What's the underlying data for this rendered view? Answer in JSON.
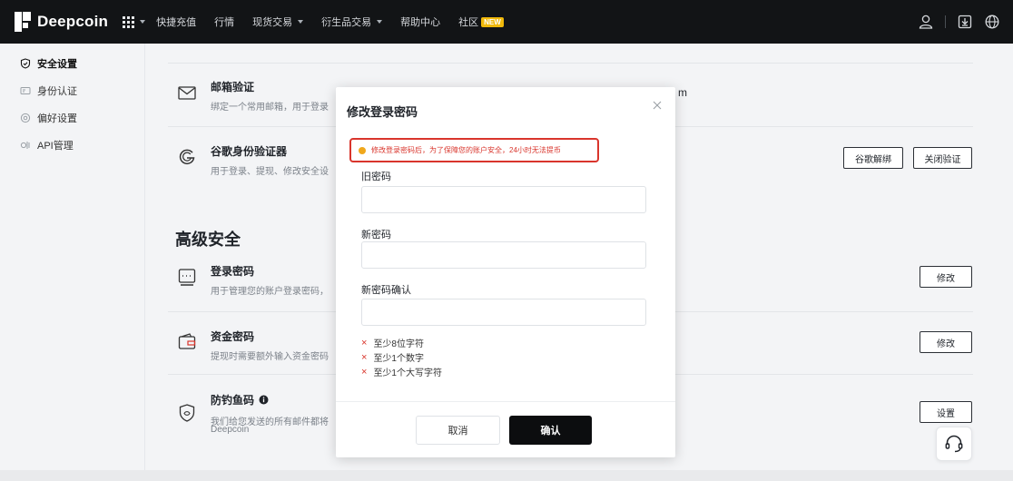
{
  "brand": {
    "name": "Deepcoin"
  },
  "nav": {
    "items": [
      {
        "label": "快捷充值",
        "has_dropdown": false
      },
      {
        "label": "行情",
        "has_dropdown": false
      },
      {
        "label": "现货交易",
        "has_dropdown": true
      },
      {
        "label": "衍生品交易",
        "has_dropdown": true
      },
      {
        "label": "帮助中心",
        "has_dropdown": false
      },
      {
        "label": "社区",
        "has_dropdown": false,
        "badge": "NEW"
      }
    ],
    "right_icons": [
      "user-icon",
      "download-icon",
      "globe-icon"
    ]
  },
  "sidebar": {
    "items": [
      {
        "label": "安全设置",
        "icon": "shield-icon",
        "active": true
      },
      {
        "label": "身份认证",
        "icon": "id-card-icon",
        "active": false
      },
      {
        "label": "偏好设置",
        "icon": "preferences-icon",
        "active": false
      },
      {
        "label": "API管理",
        "icon": "api-icon",
        "active": false
      }
    ]
  },
  "main": {
    "email": {
      "title": "邮箱验证",
      "desc": "绑定一个常用邮箱，用于登录",
      "partial": "m"
    },
    "google": {
      "title": "谷歌身份验证器",
      "desc": "用于登录、提现、修改安全设",
      "unbind_label": "谷歌解绑",
      "disable_label": "关闭验证"
    },
    "section_title": "高级安全",
    "login_password": {
      "title": "登录密码",
      "desc": "用于管理您的账户登录密码，",
      "action_label": "修改"
    },
    "fund_password": {
      "title": "资金密码",
      "desc": "提现时需要额外输入资金密码",
      "action_label": "修改"
    },
    "anti_phishing": {
      "title": "防钓鱼码",
      "desc_line1": "我们给您发送的所有邮件都将",
      "desc_line2": "Deepcoin",
      "action_label": "设置"
    }
  },
  "modal": {
    "title": "修改登录密码",
    "warning": "修改登录密码后，为了保障您的账户安全，24小时无法提币",
    "old_password_label": "旧密码",
    "old_password_value": "",
    "new_password_label": "新密码",
    "new_password_value": "",
    "confirm_password_label": "新密码确认",
    "confirm_password_value": "",
    "rules": [
      "至少8位字符",
      "至少1个数字",
      "至少1个大写字符"
    ],
    "cancel_label": "取消",
    "confirm_label": "确认"
  },
  "colors": {
    "accent": "#121416",
    "warning": "#d9352c",
    "warning_dot": "#f0a81c",
    "badge": "#f0b90b"
  }
}
